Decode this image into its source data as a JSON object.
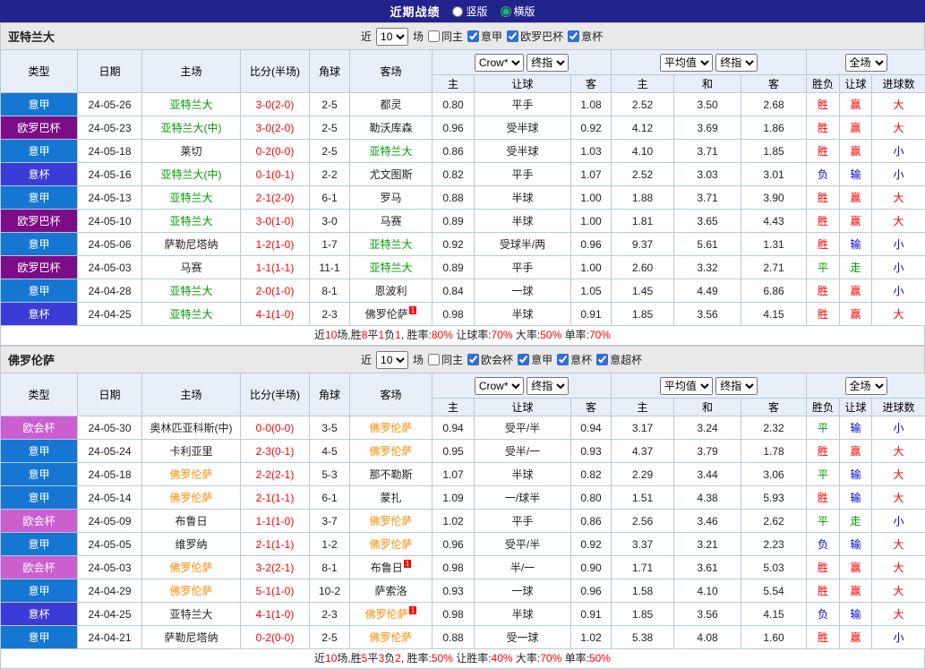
{
  "topbar": {
    "title": "近期战绩",
    "options": [
      {
        "label": "竖版",
        "selected": false
      },
      {
        "label": "横版",
        "selected": true
      }
    ]
  },
  "labels": {
    "near": "近",
    "count": "10",
    "games": "场"
  },
  "selects": {
    "company": "Crow*",
    "final": "终指",
    "average": "平均值",
    "fulltime": "全场"
  },
  "columns": {
    "type": "类型",
    "date": "日期",
    "home": "主场",
    "score": "比分(半场)",
    "corner": "角球",
    "away": "客场",
    "h": "主",
    "handicap": "让球",
    "a": "客",
    "avg_h": "主",
    "avg_d": "和",
    "avg_a": "客",
    "wl": "胜负",
    "hc": "让球",
    "goals": "进球数"
  },
  "league_colors": {
    "意甲": "#1577d2",
    "欧罗巴杯": "#7c0d86",
    "意杯": "#3b3bd8",
    "欧会杯": "#cc5fd0"
  },
  "result_colors": {
    "胜": "#ff0000",
    "赢": "#ff0000",
    "大": "#ff0000",
    "负": "#0000dd",
    "输": "#0000dd",
    "小": "#0000dd",
    "平": "#009900",
    "走": "#009900"
  },
  "sections": [
    {
      "title": "亚特兰大",
      "highlight_color": "#009900",
      "filters": [
        {
          "label": "同主",
          "checked": false
        },
        {
          "label": "意甲",
          "checked": true
        },
        {
          "label": "欧罗巴杯",
          "checked": true
        },
        {
          "label": "意杯",
          "checked": true
        }
      ],
      "rows": [
        {
          "league": "意甲",
          "date": "24-05-26",
          "home": "亚特兰大",
          "home_hl": true,
          "score": "3-0(2-0)",
          "corner": "2-5",
          "away": "都灵",
          "odds": [
            "0.80",
            "平手",
            "1.08"
          ],
          "avg": [
            "2.52",
            "3.50",
            "2.68"
          ],
          "res": [
            "胜",
            "赢",
            "大"
          ]
        },
        {
          "league": "欧罗巴杯",
          "date": "24-05-23",
          "home": "亚特兰大(中)",
          "home_hl": true,
          "score": "3-0(2-0)",
          "corner": "2-5",
          "away": "勒沃库森",
          "odds": [
            "0.96",
            "受半球",
            "0.92"
          ],
          "avg": [
            "4.12",
            "3.69",
            "1.86"
          ],
          "res": [
            "胜",
            "赢",
            "大"
          ]
        },
        {
          "league": "意甲",
          "date": "24-05-18",
          "home": "莱切",
          "score": "0-2(0-0)",
          "corner": "2-5",
          "away": "亚特兰大",
          "away_hl": true,
          "odds": [
            "0.86",
            "受半球",
            "1.03"
          ],
          "avg": [
            "4.10",
            "3.71",
            "1.85"
          ],
          "res": [
            "胜",
            "赢",
            "小"
          ]
        },
        {
          "league": "意杯",
          "date": "24-05-16",
          "home": "亚特兰大(中)",
          "home_hl": true,
          "score": "0-1(0-1)",
          "corner": "2-2",
          "away": "尤文图斯",
          "odds": [
            "0.82",
            "平手",
            "1.07"
          ],
          "avg": [
            "2.52",
            "3.03",
            "3.01"
          ],
          "res": [
            "负",
            "输",
            "小"
          ]
        },
        {
          "league": "意甲",
          "date": "24-05-13",
          "home": "亚特兰大",
          "home_hl": true,
          "score": "2-1(2-0)",
          "corner": "6-1",
          "away": "罗马",
          "odds": [
            "0.88",
            "半球",
            "1.00"
          ],
          "avg": [
            "1.88",
            "3.71",
            "3.90"
          ],
          "res": [
            "胜",
            "赢",
            "大"
          ]
        },
        {
          "league": "欧罗巴杯",
          "date": "24-05-10",
          "home": "亚特兰大",
          "home_hl": true,
          "score": "3-0(1-0)",
          "corner": "3-0",
          "away": "马赛",
          "odds": [
            "0.89",
            "半球",
            "1.00"
          ],
          "avg": [
            "1.81",
            "3.65",
            "4.43"
          ],
          "res": [
            "胜",
            "赢",
            "大"
          ]
        },
        {
          "league": "意甲",
          "date": "24-05-06",
          "home": "萨勒尼塔纳",
          "score": "1-2(1-0)",
          "corner": "1-7",
          "away": "亚特兰大",
          "away_hl": true,
          "odds": [
            "0.92",
            "受球半/两",
            "0.96"
          ],
          "avg": [
            "9.37",
            "5.61",
            "1.31"
          ],
          "res": [
            "胜",
            "输",
            "小"
          ]
        },
        {
          "league": "欧罗巴杯",
          "date": "24-05-03",
          "home": "马赛",
          "score": "1-1(1-1)",
          "corner": "11-1",
          "away": "亚特兰大",
          "away_hl": true,
          "odds": [
            "0.89",
            "平手",
            "1.00"
          ],
          "avg": [
            "2.60",
            "3.32",
            "2.71"
          ],
          "res": [
            "平",
            "走",
            "小"
          ]
        },
        {
          "league": "意甲",
          "date": "24-04-28",
          "home": "亚特兰大",
          "home_hl": true,
          "score": "2-0(1-0)",
          "corner": "8-1",
          "away": "恩波利",
          "odds": [
            "0.84",
            "一球",
            "1.05"
          ],
          "avg": [
            "1.45",
            "4.49",
            "6.86"
          ],
          "res": [
            "胜",
            "赢",
            "小"
          ]
        },
        {
          "league": "意杯",
          "date": "24-04-25",
          "home": "亚特兰大",
          "home_hl": true,
          "score": "4-1(1-0)",
          "corner": "2-3",
          "away": "佛罗伦萨",
          "away_sup": "1",
          "odds": [
            "0.98",
            "半球",
            "0.91"
          ],
          "avg": [
            "1.85",
            "3.56",
            "4.15"
          ],
          "res": [
            "胜",
            "赢",
            "大"
          ]
        }
      ],
      "footer": [
        {
          "t": "近",
          "red": false
        },
        {
          "t": "10",
          "red": true
        },
        {
          "t": "场,胜",
          "red": false
        },
        {
          "t": "8",
          "red": true
        },
        {
          "t": "平",
          "red": false
        },
        {
          "t": "1",
          "red": true
        },
        {
          "t": "负",
          "red": false
        },
        {
          "t": "1",
          "red": true
        },
        {
          "t": ", 胜率:",
          "red": false
        },
        {
          "t": "80%",
          "red": true
        },
        {
          "t": " 让球率:",
          "red": false
        },
        {
          "t": "70%",
          "red": true
        },
        {
          "t": " 大率:",
          "red": false
        },
        {
          "t": "50%",
          "red": true
        },
        {
          "t": " 单率:",
          "red": false
        },
        {
          "t": "70%",
          "red": true
        }
      ]
    },
    {
      "title": "佛罗伦萨",
      "highlight_color": "#ff8a00",
      "filters": [
        {
          "label": "同主",
          "checked": false
        },
        {
          "label": "欧会杯",
          "checked": true
        },
        {
          "label": "意甲",
          "checked": true
        },
        {
          "label": "意杯",
          "checked": true
        },
        {
          "label": "意超杯",
          "checked": true
        }
      ],
      "rows": [
        {
          "league": "欧会杯",
          "date": "24-05-30",
          "home": "奥林匹亚科斯(中)",
          "score": "0-0(0-0)",
          "corner": "3-5",
          "away": "佛罗伦萨",
          "away_hl": true,
          "odds": [
            "0.94",
            "受平/半",
            "0.94"
          ],
          "avg": [
            "3.17",
            "3.24",
            "2.32"
          ],
          "res": [
            "平",
            "输",
            "小"
          ]
        },
        {
          "league": "意甲",
          "date": "24-05-24",
          "home": "卡利亚里",
          "score": "2-3(0-1)",
          "corner": "4-5",
          "away": "佛罗伦萨",
          "away_hl": true,
          "odds": [
            "0.95",
            "受半/一",
            "0.93"
          ],
          "avg": [
            "4.37",
            "3.79",
            "1.78"
          ],
          "res": [
            "胜",
            "赢",
            "大"
          ]
        },
        {
          "league": "意甲",
          "date": "24-05-18",
          "home": "佛罗伦萨",
          "home_hl": true,
          "score": "2-2(2-1)",
          "corner": "5-3",
          "away": "那不勒斯",
          "odds": [
            "1.07",
            "半球",
            "0.82"
          ],
          "avg": [
            "2.29",
            "3.44",
            "3.06"
          ],
          "res": [
            "平",
            "输",
            "大"
          ]
        },
        {
          "league": "意甲",
          "date": "24-05-14",
          "home": "佛罗伦萨",
          "home_hl": true,
          "score": "2-1(1-1)",
          "corner": "6-1",
          "away": "蒙扎",
          "odds": [
            "1.09",
            "一/球半",
            "0.80"
          ],
          "avg": [
            "1.51",
            "4.38",
            "5.93"
          ],
          "res": [
            "胜",
            "输",
            "大"
          ]
        },
        {
          "league": "欧会杯",
          "date": "24-05-09",
          "home": "布鲁日",
          "score": "1-1(1-0)",
          "corner": "3-7",
          "away": "佛罗伦萨",
          "away_hl": true,
          "odds": [
            "1.02",
            "平手",
            "0.86"
          ],
          "avg": [
            "2.56",
            "3.46",
            "2.62"
          ],
          "res": [
            "平",
            "走",
            "小"
          ]
        },
        {
          "league": "意甲",
          "date": "24-05-05",
          "home": "维罗纳",
          "score": "2-1(1-1)",
          "corner": "1-2",
          "away": "佛罗伦萨",
          "away_hl": true,
          "odds": [
            "0.96",
            "受平/半",
            "0.92"
          ],
          "avg": [
            "3.37",
            "3.21",
            "2.23"
          ],
          "res": [
            "负",
            "输",
            "大"
          ]
        },
        {
          "league": "欧会杯",
          "date": "24-05-03",
          "home": "佛罗伦萨",
          "home_hl": true,
          "score": "3-2(2-1)",
          "corner": "8-1",
          "away": "布鲁日",
          "away_sup": "1",
          "odds": [
            "0.98",
            "半/一",
            "0.90"
          ],
          "avg": [
            "1.71",
            "3.61",
            "5.03"
          ],
          "res": [
            "胜",
            "赢",
            "大"
          ]
        },
        {
          "league": "意甲",
          "date": "24-04-29",
          "home": "佛罗伦萨",
          "home_hl": true,
          "score": "5-1(1-0)",
          "corner": "10-2",
          "away": "萨索洛",
          "odds": [
            "0.93",
            "一球",
            "0.96"
          ],
          "avg": [
            "1.58",
            "4.10",
            "5.54"
          ],
          "res": [
            "胜",
            "赢",
            "大"
          ]
        },
        {
          "league": "意杯",
          "date": "24-04-25",
          "home": "亚特兰大",
          "score": "4-1(1-0)",
          "corner": "2-3",
          "away": "佛罗伦萨",
          "away_hl": true,
          "away_sup": "1",
          "odds": [
            "0.98",
            "半球",
            "0.91"
          ],
          "avg": [
            "1.85",
            "3.56",
            "4.15"
          ],
          "res": [
            "负",
            "输",
            "大"
          ]
        },
        {
          "league": "意甲",
          "date": "24-04-21",
          "home": "萨勒尼塔纳",
          "score": "0-2(0-0)",
          "corner": "2-5",
          "away": "佛罗伦萨",
          "away_hl": true,
          "odds": [
            "0.88",
            "受一球",
            "1.02"
          ],
          "avg": [
            "5.38",
            "4.08",
            "1.60"
          ],
          "res": [
            "胜",
            "赢",
            "小"
          ]
        }
      ],
      "footer": [
        {
          "t": "近",
          "red": false
        },
        {
          "t": "10",
          "red": true
        },
        {
          "t": "场,胜",
          "red": false
        },
        {
          "t": "5",
          "red": true
        },
        {
          "t": "平",
          "red": false
        },
        {
          "t": "3",
          "red": true
        },
        {
          "t": "负",
          "red": false
        },
        {
          "t": "2",
          "red": true
        },
        {
          "t": ", 胜率:",
          "red": false
        },
        {
          "t": "50%",
          "red": true
        },
        {
          "t": " 让胜率:",
          "red": false
        },
        {
          "t": "40%",
          "red": true
        },
        {
          "t": " 大率:",
          "red": false
        },
        {
          "t": "70%",
          "red": true
        },
        {
          "t": " 单率:",
          "red": false
        },
        {
          "t": "50%",
          "red": true
        }
      ]
    }
  ]
}
